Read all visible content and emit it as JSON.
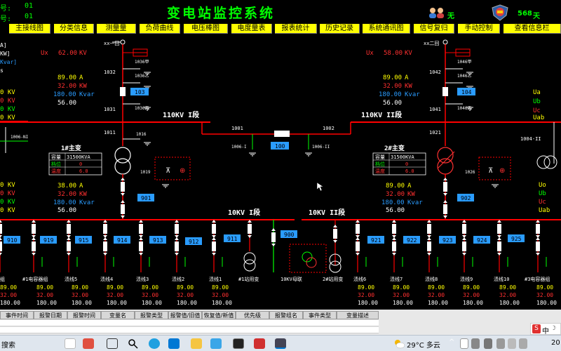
{
  "titlebar": {
    "label_top": "号:",
    "value_top": "01",
    "label_bottom": "号:",
    "value_bottom": "01",
    "title": "变电站监控系统",
    "status_text": "无",
    "days_value": "568",
    "days_unit": "天"
  },
  "menu": [
    {
      "label": "主接线图"
    },
    {
      "label": "分类信息"
    },
    {
      "label": "测量量"
    },
    {
      "label": "负荷曲线"
    },
    {
      "label": "电压棒图"
    },
    {
      "label": "电度量表"
    },
    {
      "label": "报表统计"
    },
    {
      "label": "历史记录"
    },
    {
      "label": "系统通讯图"
    },
    {
      "label": "信号复归"
    },
    {
      "label": "手动控制"
    },
    {
      "label": "查看信息栏"
    }
  ],
  "left_partial": {
    "unit1": "A]",
    "unit2": "KW]",
    "unit3": "Kvar]",
    "unit4": "s",
    "kv": [
      "0 KV",
      "0 KV",
      "0 KV",
      "0 KV"
    ],
    "kv_bottom": [
      "0 KV",
      "0 KV",
      "0 KV",
      "0 KV"
    ]
  },
  "bus_110_1": {
    "label": "110KV I段",
    "ux": "Ux",
    "ux_value": "62.00",
    "ux_unit": "KV",
    "breaker": "103",
    "isolators": [
      "1036甲",
      "1036乙",
      "1036丙"
    ],
    "switches": [
      "1032",
      "1031",
      "1011",
      "1016",
      "1019",
      "1006-I"
    ],
    "line_label": "xx一回",
    "meas": [
      {
        "value": "89.00",
        "unit": "A"
      },
      {
        "value": "32.00",
        "unit": "KW"
      },
      {
        "value": "180.00",
        "unit": "Kvar"
      },
      {
        "value": "56.00",
        "unit": ""
      }
    ]
  },
  "bus_110_2": {
    "label": "110KV II段",
    "ux": "Ux",
    "ux_value": "58.00",
    "ux_unit": "KV",
    "breaker": "104",
    "isolators": [
      "1046甲",
      "1046乙",
      "1046丙"
    ],
    "switches": [
      "1042",
      "1041",
      "1021",
      "1026",
      "1004-II"
    ],
    "line_label": "xx二回",
    "meas": [
      {
        "value": "89.00",
        "unit": "A"
      },
      {
        "value": "32.00",
        "unit": "KW"
      },
      {
        "value": "180.00",
        "unit": "Kvar"
      },
      {
        "value": "56.00",
        "unit": ""
      }
    ],
    "right_labels": [
      "Ua",
      "Ub",
      "Uc",
      "Uab",
      "Uo",
      "Ub",
      "Uc",
      "Uab"
    ]
  },
  "bus_tie": {
    "switch_left": "1001",
    "switch_right": "1002",
    "breaker": "100",
    "ground_left": "1006-I",
    "ground_right": "1006-II"
  },
  "transformer1": {
    "name": "1#主变",
    "capacity_label": "容量",
    "capacity": "31500KVA",
    "tap_label": "档位",
    "tap": "0",
    "temp_label": "温度",
    "temp": "6.0",
    "breaker": "901",
    "meas": [
      {
        "value": "38.00",
        "unit": "A"
      },
      {
        "value": "32.00",
        "unit": "KW"
      },
      {
        "value": "180.00",
        "unit": "Kvar"
      },
      {
        "value": "56.00",
        "unit": ""
      }
    ]
  },
  "transformer2": {
    "name": "2#主变",
    "capacity_label": "容量",
    "capacity": "31500KVA",
    "tap_label": "档位",
    "tap": "0",
    "temp_label": "温度",
    "temp": "6.0",
    "breaker": "902",
    "meas": [
      {
        "value": "89.00",
        "unit": "A"
      },
      {
        "value": "32.00",
        "unit": "KW"
      },
      {
        "value": "180.00",
        "unit": "Kvar"
      },
      {
        "value": "56.00",
        "unit": ""
      }
    ]
  },
  "bus_10_1": {
    "label": "10KV I段"
  },
  "bus_10_2": {
    "label": "10KV II段"
  },
  "feeders_left": [
    {
      "breaker": "910",
      "name": "组"
    },
    {
      "breaker": "919",
      "name": "#1电容器组"
    },
    {
      "breaker": "915",
      "name": "渍线5"
    },
    {
      "breaker": "914",
      "name": "渍线4"
    },
    {
      "breaker": "913",
      "name": "渍线3"
    },
    {
      "breaker": "912",
      "name": "渍线2"
    },
    {
      "breaker": "911",
      "name": "渍线1"
    },
    {
      "breaker": "",
      "name": "#1站用变"
    }
  ],
  "bus_tie_10": {
    "breaker": "900",
    "name": "10KV母联",
    "name2": "2#站用变"
  },
  "feeders_right": [
    {
      "breaker": "921",
      "name": "渍线6"
    },
    {
      "breaker": "922",
      "name": "渍线7"
    },
    {
      "breaker": "923",
      "name": "渍线8"
    },
    {
      "breaker": "924",
      "name": "渍线9"
    },
    {
      "breaker": "925",
      "name": "渍线10"
    },
    {
      "breaker": "",
      "name": "#3电容器组"
    }
  ],
  "feeder_values": [
    "89.00",
    "32.00",
    "180.00"
  ],
  "eventlog": {
    "headers": [
      "事件时间",
      "报警日期",
      "报警时间",
      "变量名",
      "报警类型",
      "报警值/旧值",
      "恢复值/新值",
      "优先级",
      "报警组名",
      "事件类型",
      "变量描述"
    ]
  },
  "taskbar": {
    "search": "搜索",
    "weather": "29°C 多云",
    "clock_partial": "20",
    "ime_label": "中"
  },
  "colors": {
    "bus_red": "#ff0000",
    "breaker_blue": "#2a9cff",
    "label_green": "#00ff00",
    "value_yellow": "#ffff00",
    "value_white": "#ffffff",
    "value_red": "#ff3030",
    "menu_yellow": "#ffff00"
  }
}
